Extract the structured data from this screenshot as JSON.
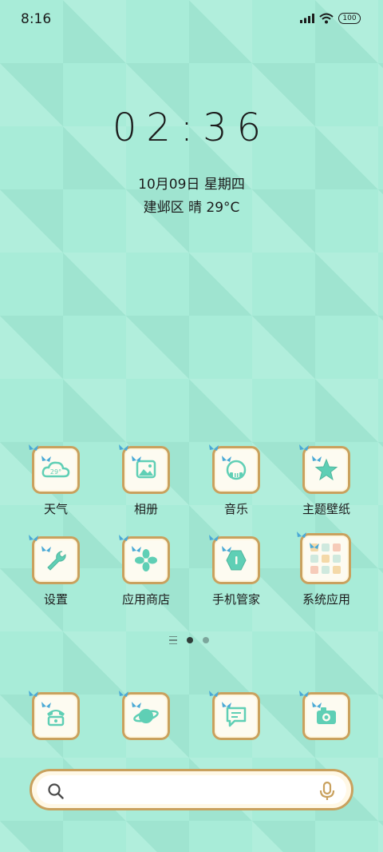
{
  "status_bar": {
    "time": "8:16",
    "battery": "100"
  },
  "lockscreen": {
    "clock": "02:36",
    "date": "10月09日 星期四",
    "weather": "建邺区 晴 29°C"
  },
  "apps_row1": [
    {
      "label": "天气",
      "icon": "weather-icon",
      "badge": "29°"
    },
    {
      "label": "相册",
      "icon": "gallery-icon"
    },
    {
      "label": "音乐",
      "icon": "music-icon"
    },
    {
      "label": "主题壁纸",
      "icon": "theme-icon"
    }
  ],
  "apps_row2": [
    {
      "label": "设置",
      "icon": "settings-icon"
    },
    {
      "label": "应用商店",
      "icon": "app-store-icon"
    },
    {
      "label": "手机管家",
      "icon": "security-icon"
    },
    {
      "label": "系统应用",
      "icon": "folder-icon"
    }
  ],
  "dock": [
    {
      "icon": "phone-icon"
    },
    {
      "icon": "browser-icon"
    },
    {
      "icon": "messages-icon"
    },
    {
      "icon": "camera-icon"
    }
  ],
  "pager": {
    "pages": 2,
    "active": 0
  },
  "search": {
    "icon": "search-icon",
    "mic": "microphone-icon"
  },
  "colors": {
    "background": "#a8ecd8",
    "frame": "#c9a15e",
    "icon_accent": "#5fcfb5",
    "butterfly": "#4aa9d6"
  }
}
